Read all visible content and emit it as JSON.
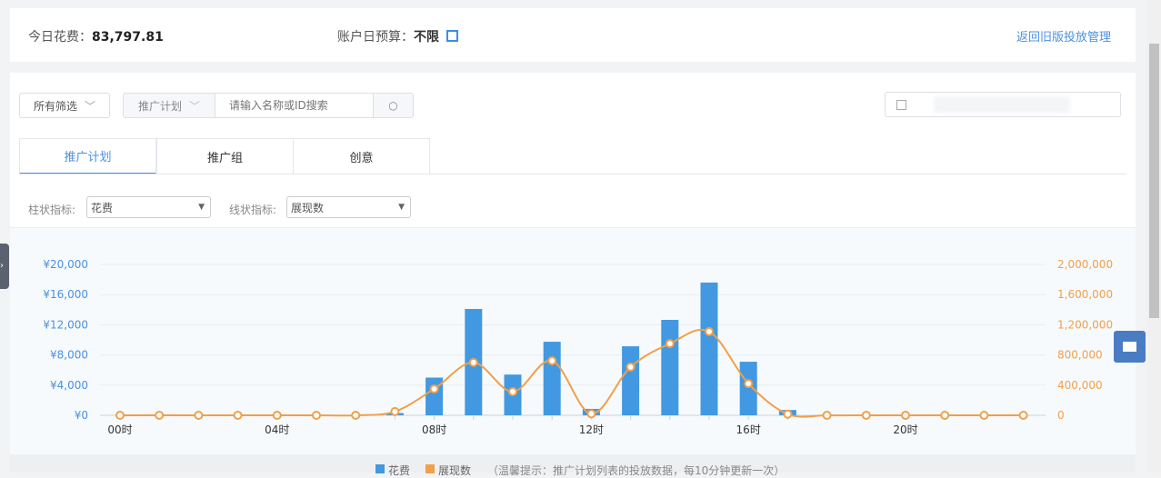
{
  "summary": {
    "spend_label": "今日花费：",
    "spend_value": "83,797.81",
    "budget_label": "账户日预算：",
    "budget_value": "不限",
    "edit_icon": "edit-icon",
    "back_link": "返回旧版投放管理"
  },
  "filters": {
    "all_filter": "所有筛选",
    "scope_select": "推广计划",
    "search_placeholder": "请输入名称或ID搜索",
    "search_icon": "search-icon",
    "date_icon": "calendar-icon"
  },
  "tabs": [
    {
      "label": "推广计划",
      "active": true
    },
    {
      "label": "推广组",
      "active": false
    },
    {
      "label": "创意",
      "active": false
    }
  ],
  "metrics": {
    "bar_label": "柱状指标:",
    "bar_value": "花费",
    "line_label": "线状指标:",
    "line_value": "展现数"
  },
  "colors": {
    "bar": "#4299e1",
    "line": "#f0a04b",
    "accent": "#4a90e2"
  },
  "chart_data": {
    "type": "bar+line",
    "categories": [
      "00时",
      "01时",
      "02时",
      "03时",
      "04时",
      "05时",
      "06时",
      "07时",
      "08时",
      "09时",
      "10时",
      "11时",
      "12时",
      "13时",
      "14时",
      "15时",
      "16时",
      "17时",
      "18时",
      "19时",
      "20时",
      "21时",
      "22时",
      "23时"
    ],
    "x_tick_labels": [
      "00时",
      "04时",
      "08时",
      "12时",
      "16时",
      "20时"
    ],
    "series": [
      {
        "name": "花费",
        "type": "bar",
        "axis": "left",
        "values": [
          0,
          0,
          0,
          0,
          0,
          0,
          0,
          300,
          5000,
          14100,
          5400,
          9750,
          850,
          9150,
          12650,
          17600,
          7100,
          700,
          0,
          0,
          0,
          0,
          0,
          0
        ]
      },
      {
        "name": "展现数",
        "type": "line",
        "axis": "right",
        "values": [
          0,
          0,
          0,
          0,
          0,
          0,
          0,
          50000,
          350000,
          700000,
          313000,
          723000,
          20000,
          640000,
          950000,
          1110000,
          420000,
          15000,
          0,
          0,
          0,
          0,
          0,
          0
        ]
      }
    ],
    "y_left": {
      "ticks": [
        "¥0",
        "¥4,000",
        "¥8,000",
        "¥12,000",
        "¥16,000",
        "¥20,000"
      ],
      "ylim": [
        0,
        20000
      ]
    },
    "y_right": {
      "ticks": [
        "0",
        "400,000",
        "800,000",
        "1,200,000",
        "1,600,000",
        "2,000,000"
      ],
      "ylim": [
        0,
        2000000
      ]
    },
    "grid": true,
    "legend_position": "bottom",
    "note": "（温馨提示：推广计划列表的投放数据，每10分钟更新一次）"
  }
}
